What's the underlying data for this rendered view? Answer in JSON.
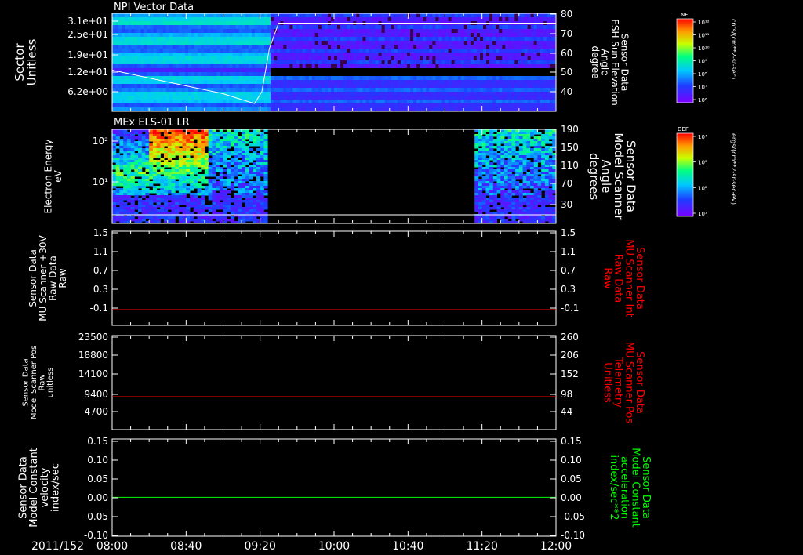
{
  "date_label": "2011/152",
  "time_ticks": [
    "08:00",
    "08:40",
    "09:20",
    "10:00",
    "10:40",
    "11:20",
    "12:00"
  ],
  "colors": {
    "background": "#000000",
    "axis": "#ffffff",
    "red_trace": "#ff0000",
    "green_trace": "#00ff00",
    "elevation_line": "#ffffff"
  },
  "colorbars": [
    {
      "label": "NF",
      "unit": "cnts/(cm**2-sr-sec)",
      "ticks": [
        "10¹²",
        "10¹¹",
        "10¹⁰",
        "10⁹",
        "10⁸",
        "10⁷",
        "10⁶"
      ]
    },
    {
      "label": "DEF",
      "unit": "ergs/(cm**2-sr-sec-eV)",
      "ticks": [
        "10⁴",
        "10³",
        "10²",
        "10¹"
      ]
    }
  ],
  "chart_data": [
    {
      "type": "heatmap",
      "title": "NPI Vector Data",
      "ylabel": [
        "Sector",
        "Unitless"
      ],
      "yticks": [
        "3.1e+01",
        "2.5e+01",
        "1.9e+01",
        "1.2e+01",
        "6.2e+00"
      ],
      "right_ylabel": [
        "Sensor Data",
        "ESH Sun Elevation",
        "Angle",
        "degree"
      ],
      "right_yticks": [
        "80",
        "70",
        "60",
        "50",
        "40"
      ],
      "right_ylim": [
        30,
        80
      ],
      "overlay_line": {
        "name": "ESH Sun Elevation Angle",
        "x": [
          "08:00",
          "08:20",
          "08:40",
          "09:00",
          "09:10",
          "09:17",
          "09:21",
          "09:25",
          "09:30",
          "12:00"
        ],
        "y": [
          51,
          47,
          43,
          39,
          36,
          34,
          40,
          62,
          75,
          75
        ]
      }
    },
    {
      "type": "heatmap",
      "title": "MEx ELS-01 LR",
      "ylabel": [
        "Electron Energy",
        "eV"
      ],
      "yticks": [
        "10²",
        "10¹"
      ],
      "right_ylabel": [
        "Sensor Data",
        "Model Scanner",
        "Angle",
        "degrees"
      ],
      "right_yticks": [
        "190",
        "150",
        "110",
        "70",
        "30"
      ],
      "data_gaps": [
        [
          "09:25",
          "11:15"
        ]
      ],
      "bottom_line_eV": 1.5
    },
    {
      "type": "line",
      "ylabel": [
        "Sensor Data",
        "MU Scanner +30V",
        "Raw Data",
        "Raw"
      ],
      "yticks": [
        "1.5",
        "1.1",
        "0.7",
        "0.3",
        "-0.1"
      ],
      "ylim": [
        -0.3,
        1.5
      ],
      "right_ylabel": [
        "Sensor Data",
        "MU Scanner Int",
        "Raw Data",
        "Raw"
      ],
      "right_yticks": [
        "1.5",
        "1.1",
        "0.7",
        "0.3",
        "-0.1"
      ],
      "series": [
        {
          "x": [
            "08:00",
            "12:00"
          ],
          "values": [
            0.0,
            0.0
          ],
          "color": "#ff0000"
        }
      ]
    },
    {
      "type": "line",
      "ylabel": [
        "Sensor Data",
        "Model Scanner Pos",
        "Raw",
        "unitless"
      ],
      "yticks": [
        "23500",
        "18800",
        "14100",
        "9400",
        "4700"
      ],
      "ylim": [
        0,
        23500
      ],
      "right_ylabel": [
        "Sensor Data",
        "MU Scanner Pos",
        "Telemetry",
        "Unitless"
      ],
      "right_yticks": [
        "260",
        "206",
        "152",
        "98",
        "44"
      ],
      "right_ylim": [
        0,
        260
      ],
      "series": [
        {
          "x": [
            "08:00",
            "12:00"
          ],
          "values": [
            91,
            91
          ],
          "axis": "right",
          "color": "#ff0000"
        }
      ]
    },
    {
      "type": "line",
      "ylabel": [
        "Sensor Data",
        "Model Constant",
        "velocity",
        "index/sec"
      ],
      "yticks": [
        "0.15",
        "0.10",
        "0.05",
        "0.00",
        "-0.05",
        "-0.10"
      ],
      "ylim": [
        -0.1,
        0.15
      ],
      "right_ylabel": [
        "Sensor Data",
        "Model Constant",
        "acceleration",
        "index/sec**2"
      ],
      "right_yticks": [
        "0.15",
        "0.10",
        "0.05",
        "0.00",
        "-0.05",
        "-0.10"
      ],
      "series": [
        {
          "x": [
            "08:00",
            "12:00"
          ],
          "values": [
            0.0,
            0.0
          ],
          "color": "#00ff00"
        }
      ]
    }
  ]
}
